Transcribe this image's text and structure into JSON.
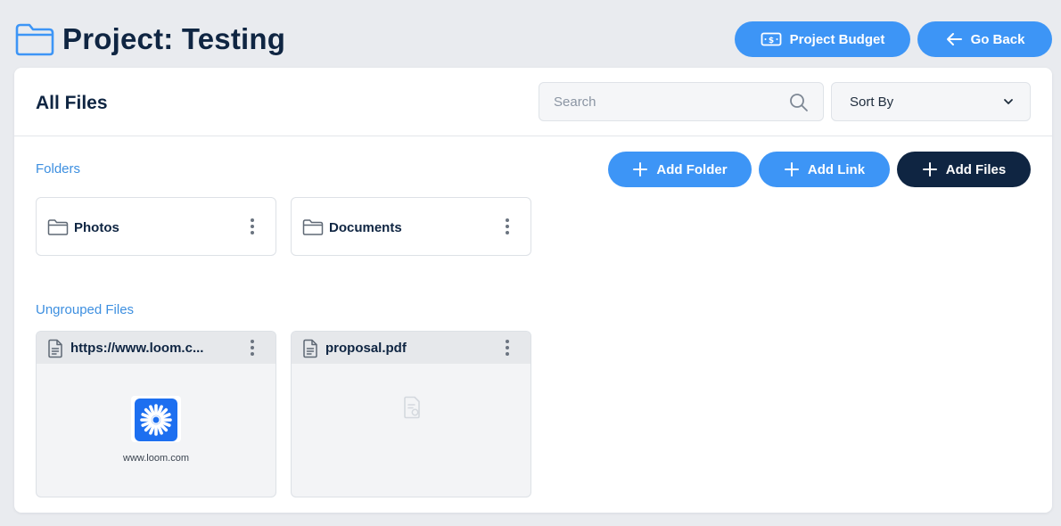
{
  "header": {
    "title": "Project: Testing",
    "project_budget_label": "Project Budget",
    "go_back_label": "Go Back"
  },
  "panel": {
    "title": "All Files",
    "search": {
      "placeholder": "Search",
      "value": ""
    },
    "sort": {
      "selected": "Sort By"
    }
  },
  "folders_section": {
    "label": "Folders",
    "actions": {
      "add_folder": "Add Folder",
      "add_link": "Add Link",
      "add_files": "Add Files"
    },
    "items": [
      {
        "name": "Photos"
      },
      {
        "name": "Documents"
      }
    ]
  },
  "files_section": {
    "label": "Ungrouped Files",
    "items": [
      {
        "name": "https://www.loom.c...",
        "preview_caption": "www.loom.com",
        "icon": "document-icon"
      },
      {
        "name": "proposal.pdf",
        "preview_caption": "",
        "icon": "document-icon"
      }
    ]
  },
  "colors": {
    "accent": "#3d95f6",
    "dark": "#0f2542",
    "link": "#3d8fe0",
    "background": "#e9ebef",
    "loom": "#1d6ff0"
  }
}
